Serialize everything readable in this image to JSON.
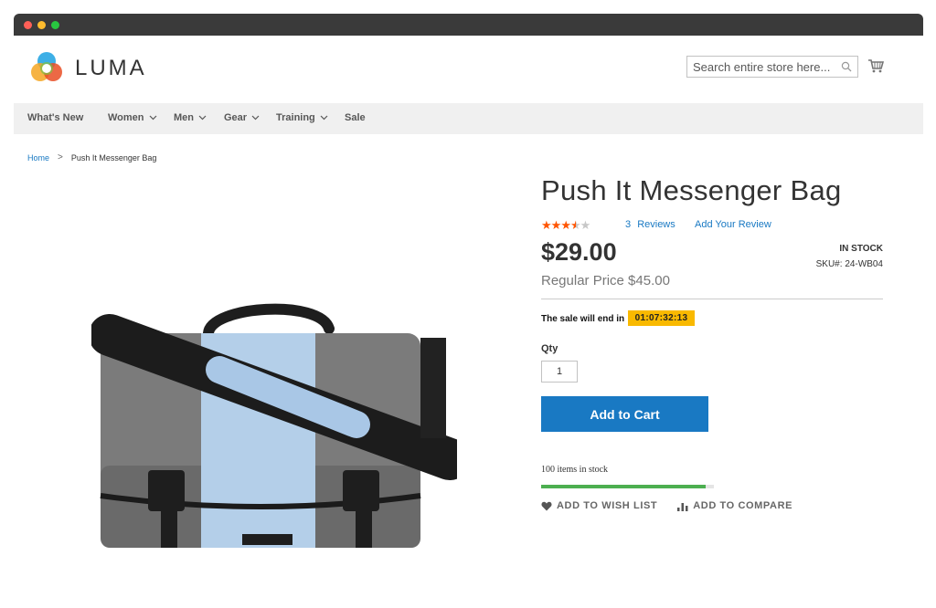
{
  "header": {
    "logo_text": "LUMA",
    "search_placeholder": "Search entire store here..."
  },
  "nav": {
    "items": [
      {
        "label": "What's New",
        "has_menu": false
      },
      {
        "label": "Women",
        "has_menu": true
      },
      {
        "label": "Men",
        "has_menu": true
      },
      {
        "label": "Gear",
        "has_menu": true
      },
      {
        "label": "Training",
        "has_menu": true
      },
      {
        "label": "Sale",
        "has_menu": false
      }
    ]
  },
  "breadcrumb": {
    "home": "Home",
    "separator": ">",
    "current": "Push It Messenger Bag"
  },
  "product": {
    "title": "Push It Messenger Bag",
    "rating_stars": 3.5,
    "rating_max": 5,
    "reviews_count": "3",
    "reviews_label": "Reviews",
    "add_review": "Add Your Review",
    "price": "$29.00",
    "regular_price": "Regular Price $45.00",
    "stock_status": "IN STOCK",
    "sku_label": "SKU#:",
    "sku": "24-WB04",
    "sale_text": "The sale will end in",
    "timer": "01:07:32:13",
    "qty_label": "Qty",
    "qty_value": "1",
    "add_to_cart": "Add to Cart",
    "stock_count": "100 items in stock",
    "stock_level_fraction": 0.95,
    "wishlist": "ADD TO WISH LIST",
    "compare": "ADD TO COMPARE"
  },
  "colors": {
    "accent": "#1979c3",
    "rating": "#ff5501",
    "timer_bg": "#f9b900",
    "stock_bar": "#4caf50"
  }
}
